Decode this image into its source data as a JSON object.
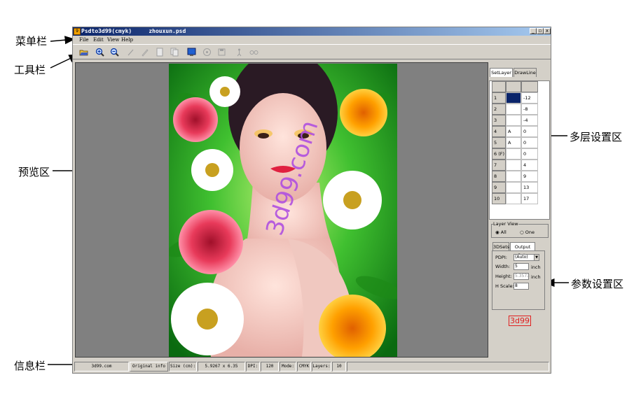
{
  "annotations": {
    "menubar": "菜单栏",
    "toolbar": "工具栏",
    "preview": "预览区",
    "layer_settings": "多层设置区",
    "param_settings": "参数设置区",
    "infobar": "信息栏"
  },
  "window": {
    "title": "Psdto3d99(cmyk)     zhouxun.psd",
    "minimize": "_",
    "maximize": "▫",
    "close": "x"
  },
  "menu": {
    "file": "File",
    "edit": "Edit",
    "view": "View",
    "help": "Help"
  },
  "preview": {
    "watermark": "3d99.com"
  },
  "right_panel": {
    "tabs": [
      "SetLayer",
      "DrawLine"
    ],
    "layers": [
      {
        "num": "1",
        "mark": "",
        "value": "-12",
        "selected": true
      },
      {
        "num": "2",
        "mark": "",
        "value": "-8"
      },
      {
        "num": "3",
        "mark": "",
        "value": "-4"
      },
      {
        "num": "4",
        "mark": "A",
        "value": "0"
      },
      {
        "num": "5",
        "mark": "A",
        "value": "0"
      },
      {
        "num": "6 (F)",
        "mark": "",
        "value": "0"
      },
      {
        "num": "7",
        "mark": "",
        "value": "4"
      },
      {
        "num": "8",
        "mark": "",
        "value": "9"
      },
      {
        "num": "9",
        "mark": "",
        "value": "13"
      },
      {
        "num": "10",
        "mark": "",
        "value": "17"
      }
    ],
    "layer_view": {
      "label": "Layer View",
      "all": "All",
      "one": "One"
    },
    "param_tabs": [
      "3DSets",
      "Output Sets"
    ],
    "params": {
      "pdpi_label": "PDPI:",
      "pdpi_value": "(Auto)",
      "width_label": "Width:",
      "width_value": "5",
      "width_unit": "inch",
      "height_label": "Height:",
      "height_value": "5.3573",
      "height_unit": "inch",
      "hscale_label": "H Scale:",
      "hscale_value": "8"
    },
    "logo": "3d99"
  },
  "status": {
    "site": "3d99.com",
    "original_info": "Original info",
    "size_label": "Size (cm):",
    "size_value": "5.9267 x 6.35",
    "dpi_label": "DPI:",
    "dpi_value": "120",
    "mode_label": "Mode:",
    "mode_value": "CMYK",
    "layers_label": "Layers:",
    "layers_value": "10"
  },
  "colors": {
    "title_start": "#0a246a",
    "title_end": "#a6caf0",
    "face": "#d4d0c8",
    "preview_bg": "#808080",
    "selected_cell": "#0a246a",
    "logo_red": "#e02020"
  }
}
